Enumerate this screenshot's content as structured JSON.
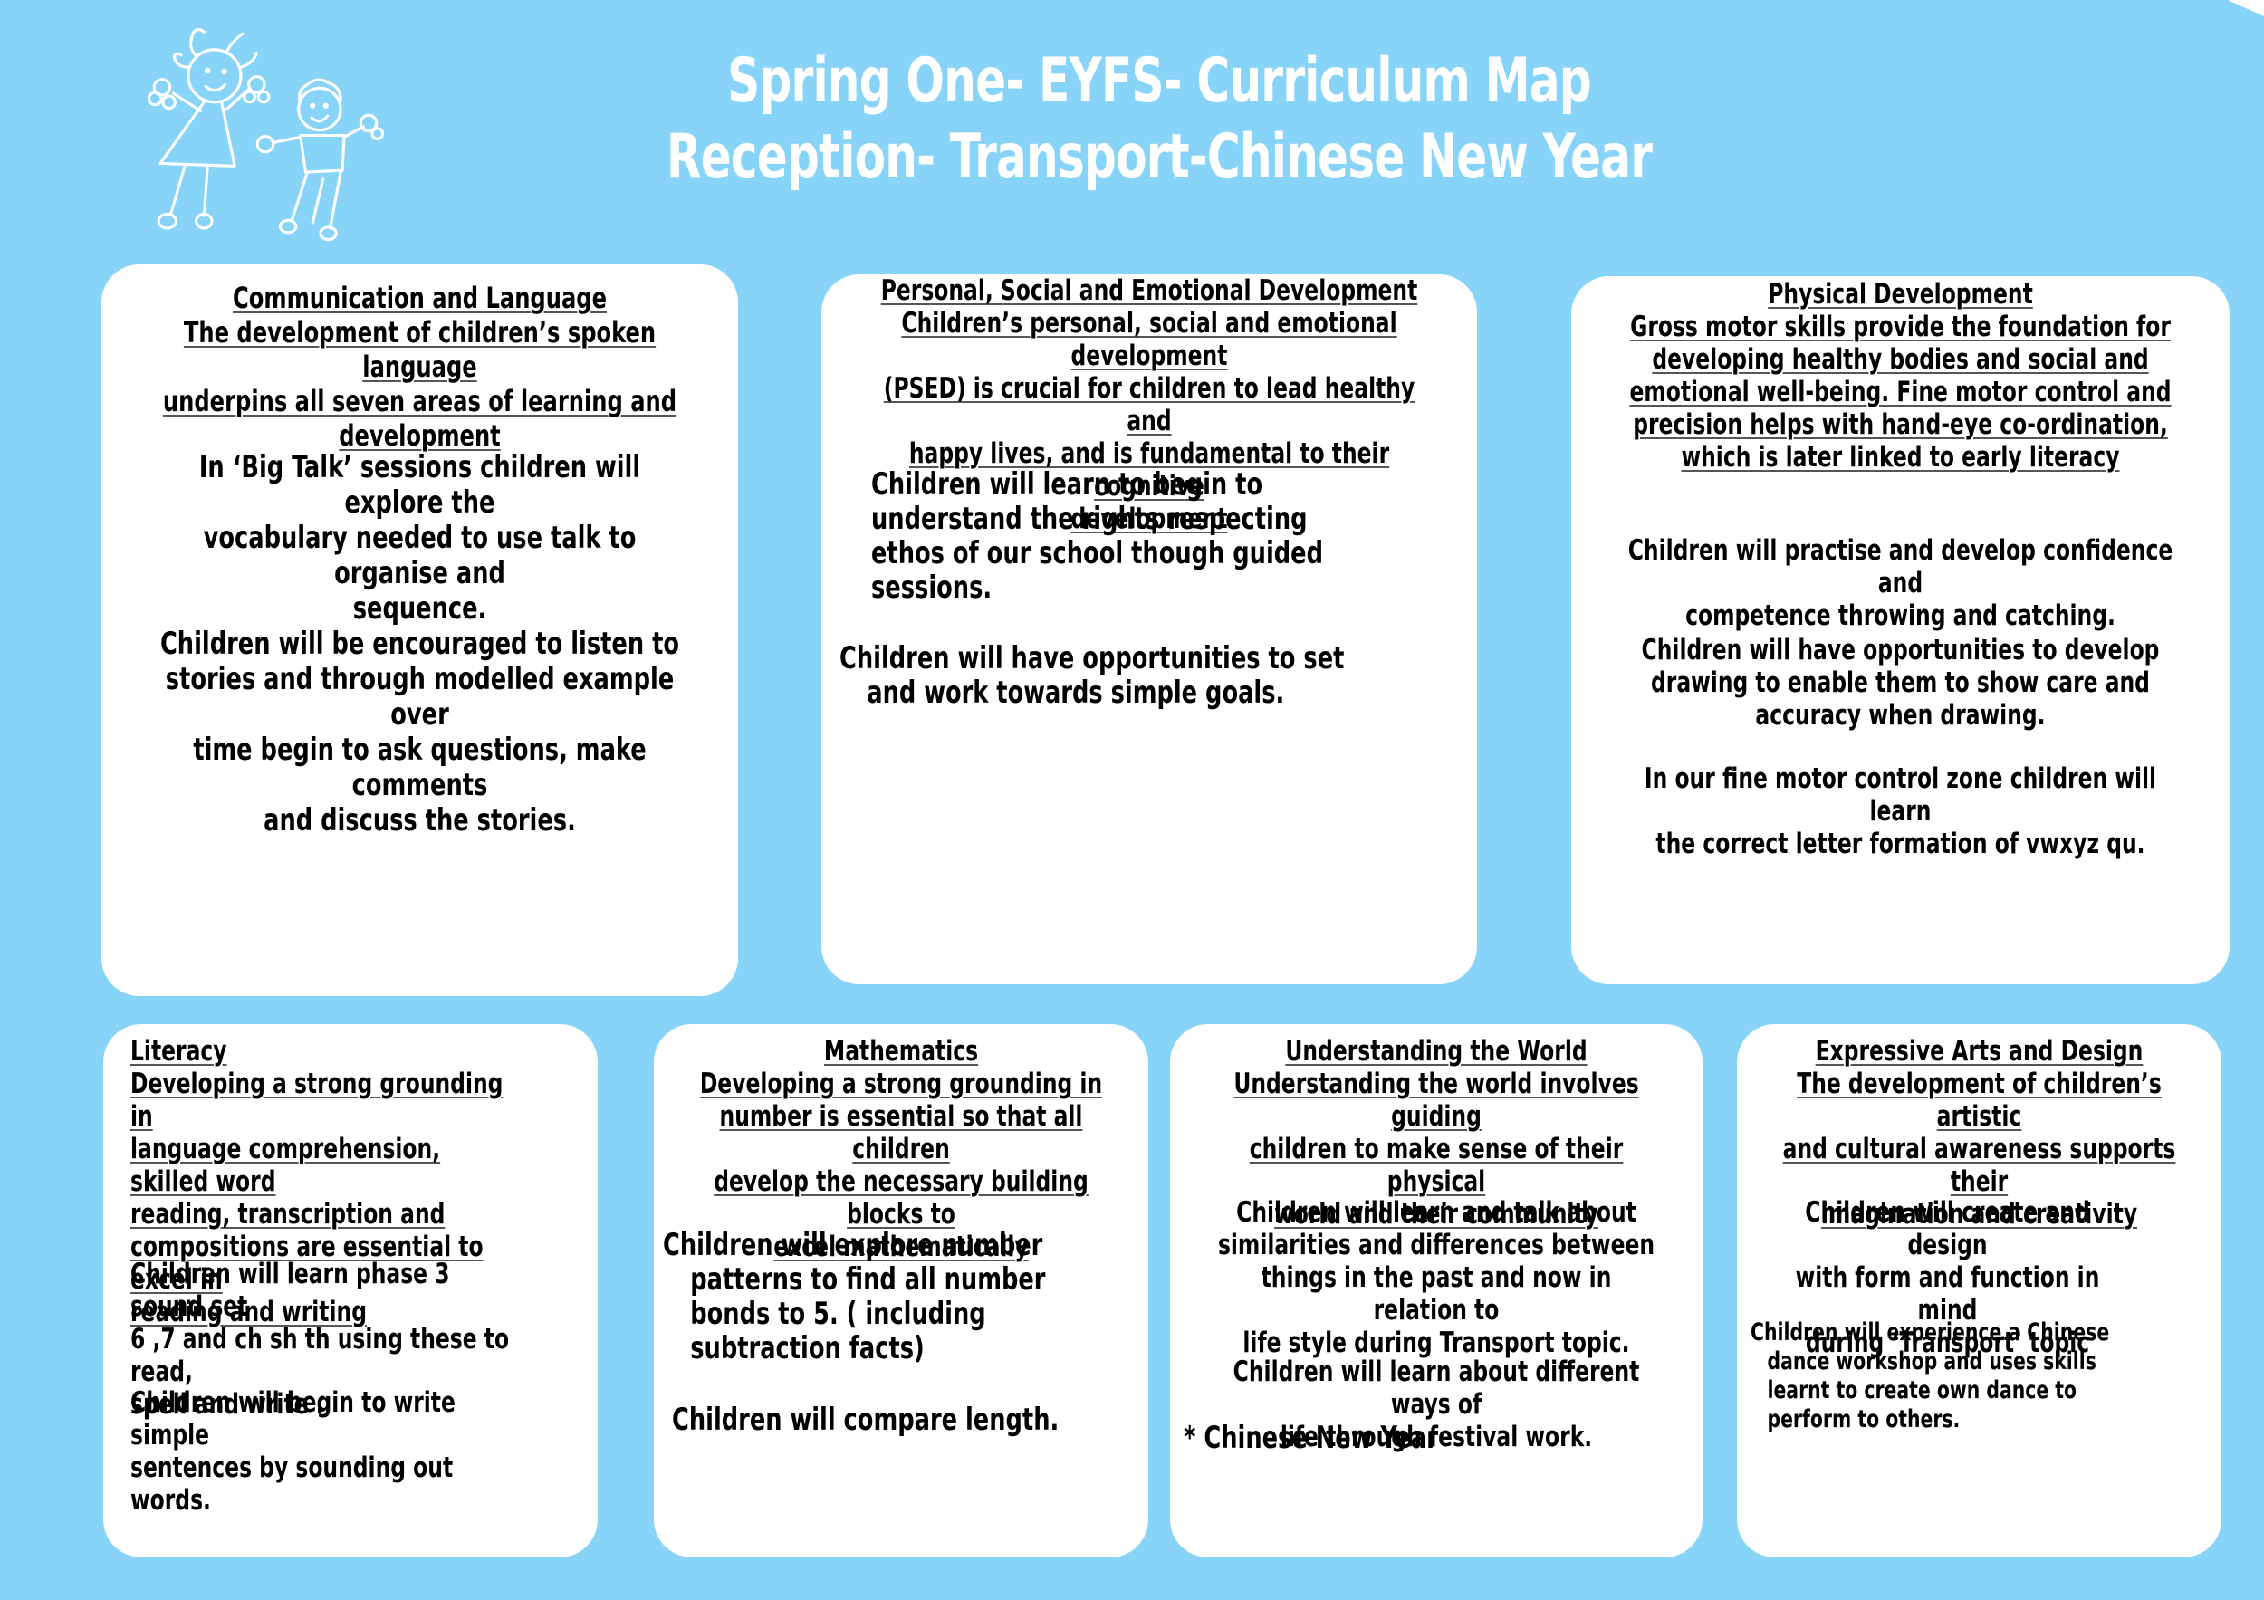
{
  "page": {
    "background_color": "#87d4f8",
    "card_color": "#ffffff",
    "title_color": "#ffffff"
  },
  "header": {
    "title_line1": "Spring One- EYFS- Curriculum Map",
    "title_line2": "Reception- Transport-Chinese New Year",
    "logo_icon": "children-drawing-icon"
  },
  "cards": {
    "communication_language": {
      "heading_lines": [
        "Communication and Language",
        "The development of children’s spoken language",
        "underpins all seven areas of learning and",
        "development"
      ],
      "paragraphs": [
        [
          "In  ‘Big Talk’ sessions children will explore the",
          "vocabulary needed to use talk to organise and",
          "sequence."
        ],
        [
          "Children will be encouraged to listen to",
          "stories and through modelled example over",
          "time begin to ask questions, make comments",
          "and discuss the stories."
        ]
      ]
    },
    "psed": {
      "heading_lines": [
        "Personal, Social and Emotional Development",
        "Children’s personal, social and emotional development",
        "(PSED) is crucial for children to lead healthy and",
        "happy lives, and is fundamental to their cognitive",
        "development"
      ],
      "paragraphs": [
        [
          "Children will learn to begin to",
          "understand the rights respecting",
          "ethos of our school though guided",
          "sessions."
        ],
        [
          "Children will have opportunities to set",
          "and work towards simple goals."
        ]
      ]
    },
    "physical_development": {
      "heading_lines": [
        "Physical Development",
        "Gross motor skills provide the foundation for",
        "developing healthy bodies and social and",
        "emotional well-being. Fine motor control and",
        "precision helps with hand-eye co-ordination,",
        "which is later linked to early literacy"
      ],
      "paragraphs": [
        [
          "Children will practise and develop confidence and",
          "competence throwing and catching."
        ],
        [
          "Children will have opportunities to develop",
          "drawing to enable them to show care and",
          "accuracy when drawing."
        ],
        [
          "In our fine motor control zone children will learn",
          "the correct letter formation of vwxyz qu."
        ]
      ]
    },
    "literacy": {
      "heading_lines": [
        "Literacy",
        "Developing a strong grounding in",
        "language comprehension, skilled word",
        "reading, transcription and",
        "compositions are essential to excel in",
        "reading and writing"
      ],
      "paragraphs": [
        [
          "Children will learn phase 3 sound set",
          "6 ,7 and ch sh th using these to read,",
          "spell and write ."
        ],
        [
          "Children will begin to write simple",
          "sentences by sounding out words."
        ]
      ]
    },
    "mathematics": {
      "heading_lines": [
        "Mathematics",
        "Developing a strong grounding in",
        "number is essential so that all children",
        "develop the necessary building blocks to",
        "excel mathematically"
      ],
      "paragraphs": [
        [
          "Children will explore number",
          "patterns to find all number",
          "bonds to 5. ( including",
          "subtraction facts)"
        ],
        [
          "Children will compare length."
        ]
      ]
    },
    "understanding_world": {
      "heading_lines": [
        "Understanding the World",
        "Understanding the world involves guiding",
        "children to make sense of their physical",
        "world and their community"
      ],
      "paragraphs": [
        [
          "Children will learn and talk about",
          "similarities and differences between",
          "things in the past and now in relation to",
          "life style during Transport topic."
        ],
        [
          "Children will learn about different ways of",
          "life through festival work."
        ],
        [
          "*  Chinese New Year"
        ]
      ]
    },
    "expressive_arts": {
      "heading_lines": [
        "Expressive Arts and Design",
        "The development of children’s artistic",
        "and cultural awareness supports their",
        "imagination and creativity"
      ],
      "paragraphs": [
        [
          "Children will create and design",
          "with form and function in mind",
          "during ‘Transport’ topic"
        ],
        [
          "Children will experience a Chinese",
          "dance workshop and uses skills",
          "learnt to create own dance to",
          "perform to others."
        ]
      ]
    }
  }
}
